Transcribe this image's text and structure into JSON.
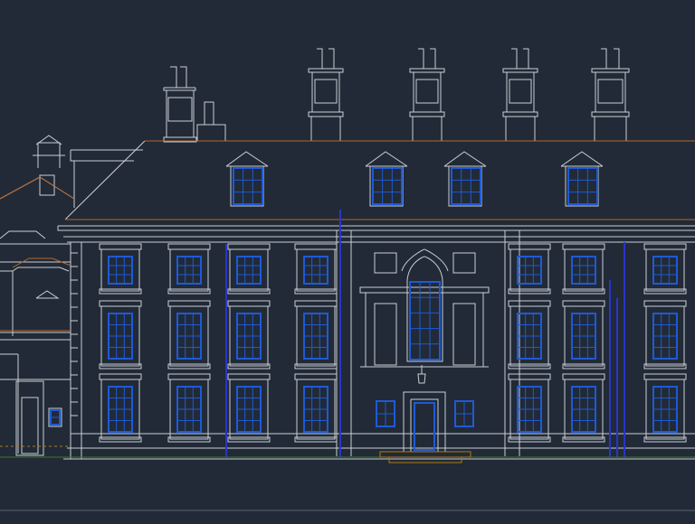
{
  "drawing": {
    "subject": "building-elevation",
    "background_color": "#212a36",
    "line_color": "#c9cfd6",
    "window_color": "#1e5ad6",
    "roof_edge_color": "#b5672e",
    "guide_line_color": "#2a34c8",
    "ground_line_color": "#3c7a2a",
    "entrance_step_color": "#b07a10",
    "labels": {
      "left_ground_note": "",
      "entrance_note": ""
    }
  }
}
